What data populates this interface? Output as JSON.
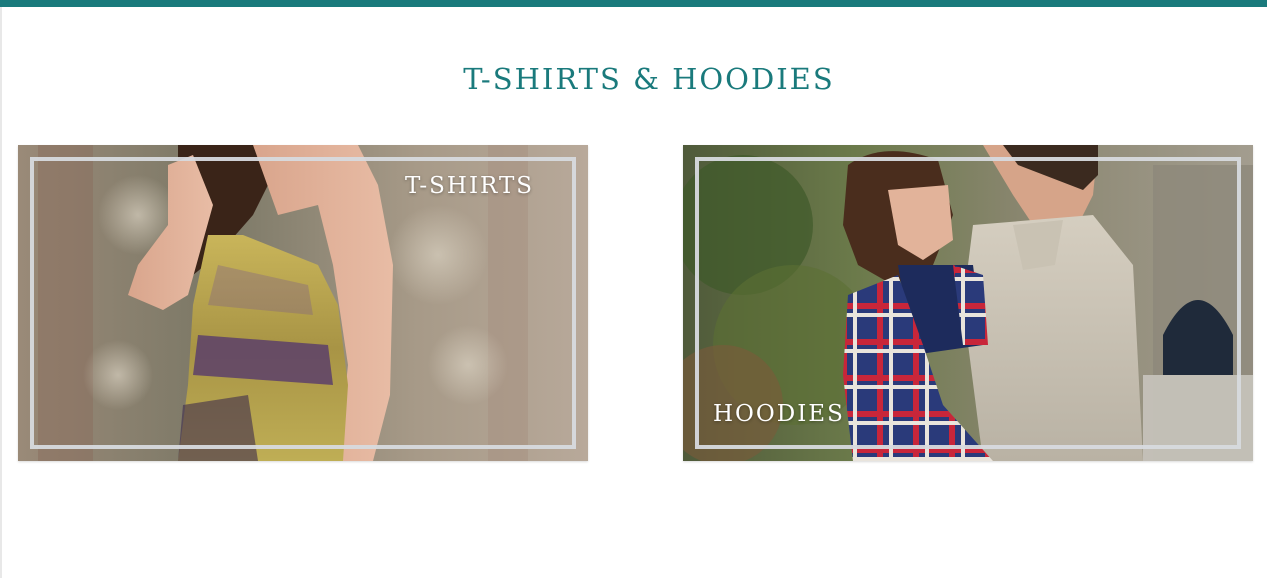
{
  "header": {
    "accent_color": "#1a7a7c"
  },
  "section": {
    "title": "T-SHIRTS & HOODIES"
  },
  "cards": [
    {
      "label": "T-SHIRTS",
      "image": "woman-in-yellow-floral-dress"
    },
    {
      "label": "HOODIES",
      "image": "couple-with-plaid-blanket"
    }
  ]
}
